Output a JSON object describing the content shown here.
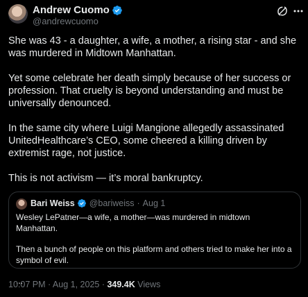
{
  "author": {
    "display_name": "Andrew Cuomo",
    "handle": "@andrewcuomo"
  },
  "icons": {
    "verified": "verified-badge-icon",
    "grok": "grok-icon",
    "more": "more-options-icon"
  },
  "colors": {
    "background": "#000000",
    "text": "#e7e9ea",
    "secondary_text": "#71767b",
    "verified_blue": "#1d9bf0",
    "border": "#2f3336"
  },
  "post": {
    "paragraphs": [
      "She was 43 - a daughter, a wife, a mother, a rising star - and she was murdered in Midtown Manhattan.",
      "Yet some celebrate her death simply because of her success or profession. That cruelty is beyond understanding and must be universally denounced.",
      "In the same city where Luigi Mangione allegedly assassinated UnitedHealthcare’s CEO, some cheered a killing driven by extremist rage, not justice.",
      "This is not activism — it’s moral bankruptcy."
    ]
  },
  "quote": {
    "display_name": "Bari Weiss",
    "handle": "@bariweiss",
    "separator": "·",
    "date": "Aug 1",
    "paragraphs": [
      "Wesley LePatner—a wife, a mother—was murdered in midtown Manhattan.",
      "Then a bunch of people on this platform and others tried to make her into a symbol of evil.",
      "..."
    ]
  },
  "meta": {
    "time_date": "10:07 PM · Aug 1, 2025 · ",
    "views_count": "349.4K",
    "views_label": " Views"
  }
}
